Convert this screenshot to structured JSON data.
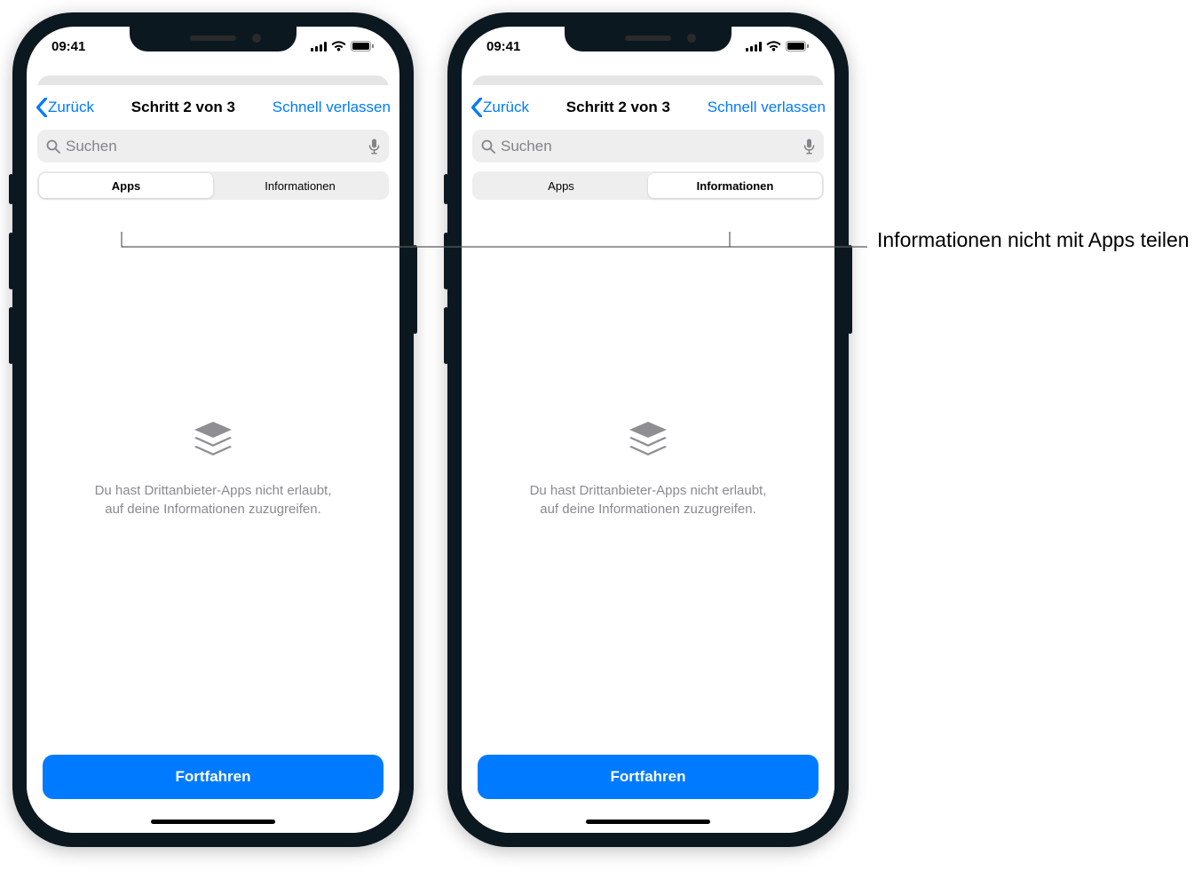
{
  "status": {
    "time": "09:41"
  },
  "nav": {
    "back": "Zurück",
    "title": "Schritt 2 von 3",
    "action": "Schnell verlassen"
  },
  "search": {
    "placeholder": "Suchen"
  },
  "tabs": {
    "apps": "Apps",
    "info": "Informationen"
  },
  "empty": {
    "line1": "Du hast Drittanbieter-Apps nicht erlaubt,",
    "line2": "auf deine Informationen zuzugreifen."
  },
  "footer": {
    "continue": "Fortfahren"
  },
  "annotation": {
    "label": "Informationen nicht mit Apps teilen"
  },
  "screens": {
    "left": {
      "active_tab": "apps"
    },
    "right": {
      "active_tab": "info"
    }
  }
}
